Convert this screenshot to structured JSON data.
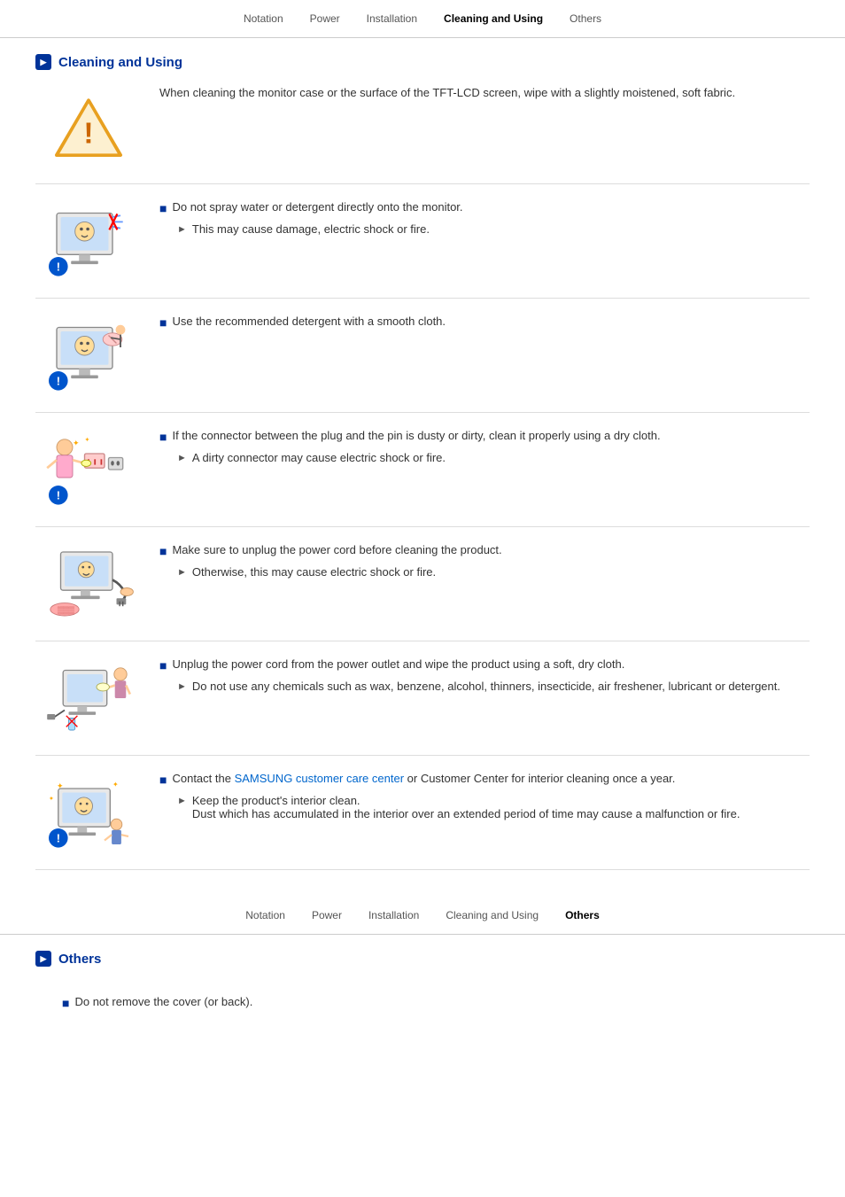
{
  "nav": {
    "items": [
      {
        "label": "Notation",
        "active": false
      },
      {
        "label": "Power",
        "active": false
      },
      {
        "label": "Installation",
        "active": false
      },
      {
        "label": "Cleaning and Using",
        "active": true
      },
      {
        "label": "Others",
        "active": false
      }
    ]
  },
  "nav2": {
    "items": [
      {
        "label": "Notation",
        "active": false
      },
      {
        "label": "Power",
        "active": false
      },
      {
        "label": "Installation",
        "active": false
      },
      {
        "label": "Cleaning and Using",
        "active": false
      },
      {
        "label": "Others",
        "active": true
      }
    ]
  },
  "cleaningSection": {
    "title": "Cleaning and Using",
    "intro": "When cleaning the monitor case or the surface of the TFT-LCD screen, wipe with a slightly moistened, soft fabric.",
    "items": [
      {
        "mainText": "Do not spray water or detergent directly onto the monitor.",
        "subText": "This may cause damage, electric shock or fire."
      },
      {
        "mainText": "Use the recommended detergent with a smooth cloth.",
        "subText": null
      },
      {
        "mainText": "If the connector between the plug and the pin is dusty or dirty, clean it properly using a dry cloth.",
        "subText": "A dirty connector may cause electric shock or fire."
      },
      {
        "mainText": "Make sure to unplug the power cord before cleaning the product.",
        "subText": "Otherwise, this may cause electric shock or fire."
      },
      {
        "mainText": "Unplug the power cord from the power outlet and wipe the product using a soft, dry cloth.",
        "subText": "Do not use any chemicals such as wax, benzene, alcohol, thinners, insecticide, air freshener, lubricant or detergent."
      },
      {
        "mainText": "Contact the SAMSUNG customer care center or Customer Center for interior cleaning once a year.",
        "subText": "Keep the product's interior clean.\nDust which has accumulated in the interior over an extended period of time may cause a malfunction or fire.",
        "hasLink": true,
        "linkText": "SAMSUNG customer care center"
      }
    ]
  },
  "othersSection": {
    "title": "Others",
    "items": [
      {
        "mainText": "Do not remove the cover (or back).",
        "subText": null
      }
    ]
  }
}
